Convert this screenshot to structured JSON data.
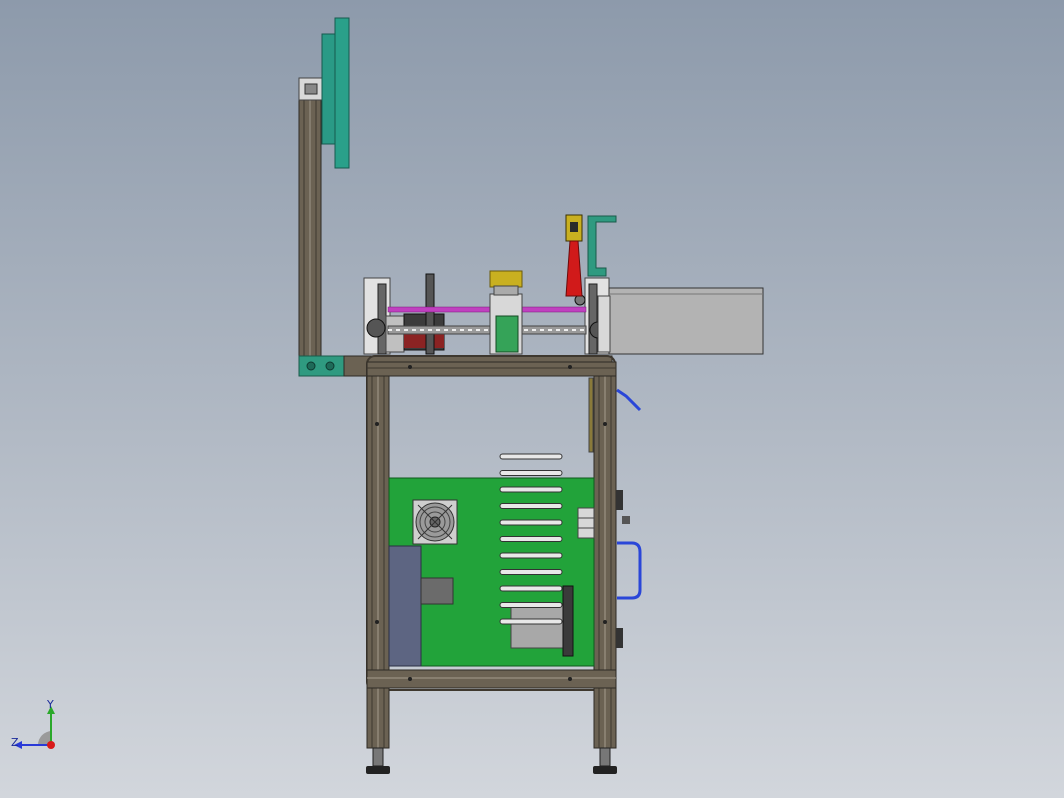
{
  "viewport": {
    "background_top": "#8d9aab",
    "background_bottom": "#d2d6dc"
  },
  "colors": {
    "frame_profile": "#6b6253",
    "frame_dark": "#3e382f",
    "panel_green": "#22a33a",
    "monitor_teal": "#2a9a86",
    "bracket_teal": "#2f9a80",
    "guide_rod": "#c040c0",
    "laser_red": "#d11a1a",
    "hose_blue": "#2a46d8",
    "motor_yellow": "#c9b020",
    "box_gray": "#b3b3b3"
  },
  "model": {
    "parts": [
      "monitor-arm-profile",
      "monitor-screen",
      "machine-frame",
      "electrical-panel",
      "cooling-fan",
      "vent-slots",
      "linear-module",
      "laser-head",
      "output-chute",
      "air-hose",
      "leveling-feet"
    ]
  },
  "triad": {
    "x_label": "Z",
    "y_label": "Y"
  }
}
